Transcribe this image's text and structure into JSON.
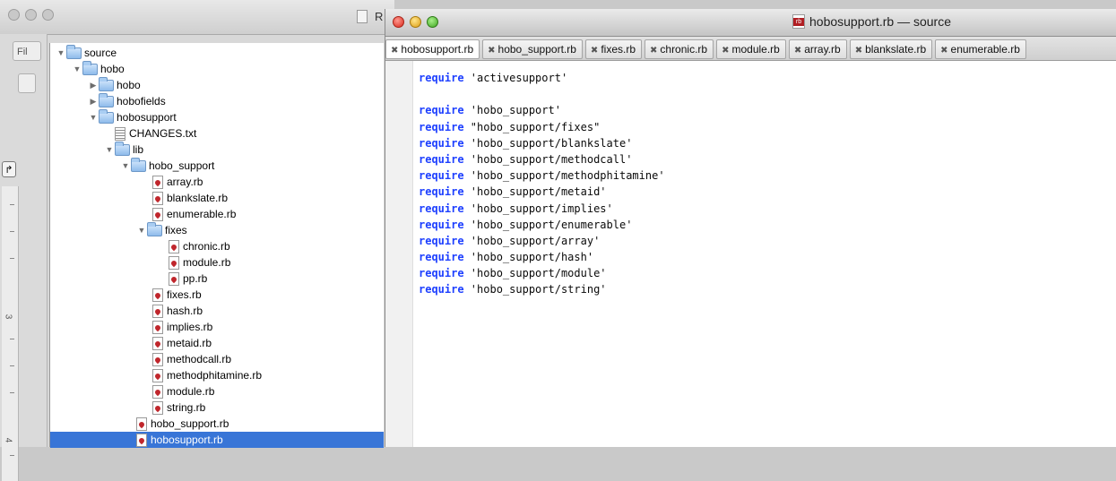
{
  "background_window": {
    "title": "R",
    "toolbar": {
      "filter_placeholder": "Fil"
    },
    "ruler": {
      "numbers": [
        "3",
        "4"
      ]
    }
  },
  "file_tree": {
    "items": [
      {
        "label": "source",
        "type": "folder",
        "expanded": true
      },
      {
        "label": "hobo",
        "type": "folder",
        "expanded": true
      },
      {
        "label": "hobo",
        "type": "folder",
        "expanded": false
      },
      {
        "label": "hobofields",
        "type": "folder",
        "expanded": false
      },
      {
        "label": "hobosupport",
        "type": "folder",
        "expanded": true
      },
      {
        "label": "CHANGES.txt",
        "type": "text-file"
      },
      {
        "label": "lib",
        "type": "folder",
        "expanded": true
      },
      {
        "label": "hobo_support",
        "type": "folder",
        "expanded": true
      },
      {
        "label": "array.rb",
        "type": "ruby-file"
      },
      {
        "label": "blankslate.rb",
        "type": "ruby-file"
      },
      {
        "label": "enumerable.rb",
        "type": "ruby-file"
      },
      {
        "label": "fixes",
        "type": "folder",
        "expanded": true
      },
      {
        "label": "chronic.rb",
        "type": "ruby-file"
      },
      {
        "label": "module.rb",
        "type": "ruby-file"
      },
      {
        "label": "pp.rb",
        "type": "ruby-file"
      },
      {
        "label": "fixes.rb",
        "type": "ruby-file"
      },
      {
        "label": "hash.rb",
        "type": "ruby-file"
      },
      {
        "label": "implies.rb",
        "type": "ruby-file"
      },
      {
        "label": "metaid.rb",
        "type": "ruby-file"
      },
      {
        "label": "methodcall.rb",
        "type": "ruby-file"
      },
      {
        "label": "methodphitamine.rb",
        "type": "ruby-file"
      },
      {
        "label": "module.rb",
        "type": "ruby-file"
      },
      {
        "label": "string.rb",
        "type": "ruby-file"
      },
      {
        "label": "hobo_support.rb",
        "type": "ruby-file"
      },
      {
        "label": "hobosupport.rb",
        "type": "ruby-file",
        "selected": true
      }
    ]
  },
  "editor": {
    "title": "hobosupport.rb — source",
    "tabs": [
      {
        "label": "hobosupport.rb",
        "active": true
      },
      {
        "label": "hobo_support.rb"
      },
      {
        "label": "fixes.rb"
      },
      {
        "label": "chronic.rb"
      },
      {
        "label": "module.rb"
      },
      {
        "label": "array.rb"
      },
      {
        "label": "blankslate.rb"
      },
      {
        "label": "enumerable.rb"
      }
    ],
    "tab_close_glyph": "✖",
    "code_lines": [
      {
        "kw": "require",
        "str": " 'activesupport'"
      },
      {
        "kw": "",
        "str": ""
      },
      {
        "kw": "require",
        "str": " 'hobo_support'"
      },
      {
        "kw": "require",
        "str": " \"hobo_support/fixes\""
      },
      {
        "kw": "require",
        "str": " 'hobo_support/blankslate'"
      },
      {
        "kw": "require",
        "str": " 'hobo_support/methodcall'"
      },
      {
        "kw": "require",
        "str": " 'hobo_support/methodphitamine'"
      },
      {
        "kw": "require",
        "str": " 'hobo_support/metaid'"
      },
      {
        "kw": "require",
        "str": " 'hobo_support/implies'"
      },
      {
        "kw": "require",
        "str": " 'hobo_support/enumerable'"
      },
      {
        "kw": "require",
        "str": " 'hobo_support/array'"
      },
      {
        "kw": "require",
        "str": " 'hobo_support/hash'"
      },
      {
        "kw": "require",
        "str": " 'hobo_support/module'"
      },
      {
        "kw": "require",
        "str": " 'hobo_support/string'"
      }
    ]
  },
  "colors": {
    "keyword": "#1e40ff",
    "selection": "#3875d7"
  }
}
